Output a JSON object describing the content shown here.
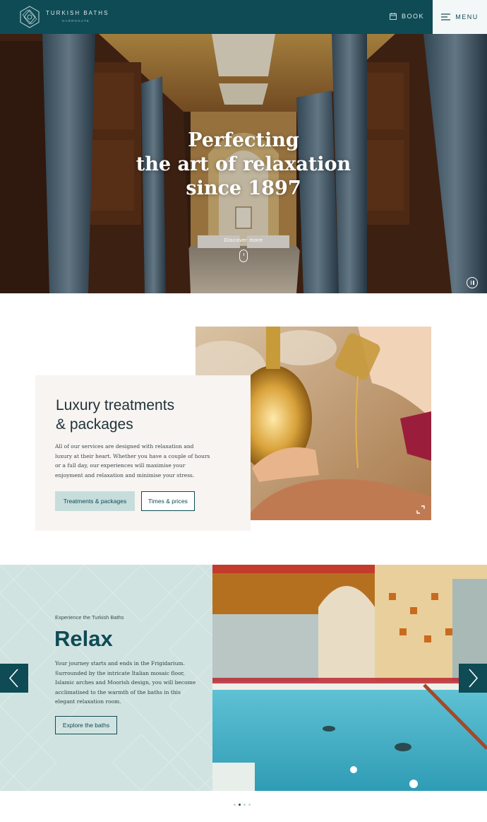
{
  "header": {
    "brand": "TURKISH BATHS",
    "brand_sub": "HARROGATE",
    "book_label": "BOOK",
    "menu_label": "MENU"
  },
  "hero": {
    "title_lines": [
      "Perfecting",
      "the art of relaxation",
      "since 1897"
    ],
    "discover_label": "Discover more"
  },
  "treatments": {
    "title_line1": "Luxury treatments",
    "title_line2": "& packages",
    "body": "All of our services are designed with relaxation and luxury at their heart. Whether you have a couple of hours or a full day, our experiences will maximise your enjoyment and relaxation and minimise your stress.",
    "primary_button": "Treatments & packages",
    "secondary_button": "Times & prices"
  },
  "slider": {
    "eyebrow": "Experience the Turkish Baths",
    "title": "Relax",
    "body": "Your journey starts and ends in the Frigidarium. Surrounded by the intricate Italian mosaic floor, Islamic arches and Moorish design, you will become acclimatised to the warmth of the baths in this elegant relaxation room.",
    "button": "Explore the baths",
    "active_slide": 2,
    "slide_count": 4
  },
  "colors": {
    "brand": "#0e4b55",
    "accent_light": "#c6dddc",
    "panel_mint": "#d1e3e1",
    "card_cream": "#f7f4f2"
  }
}
